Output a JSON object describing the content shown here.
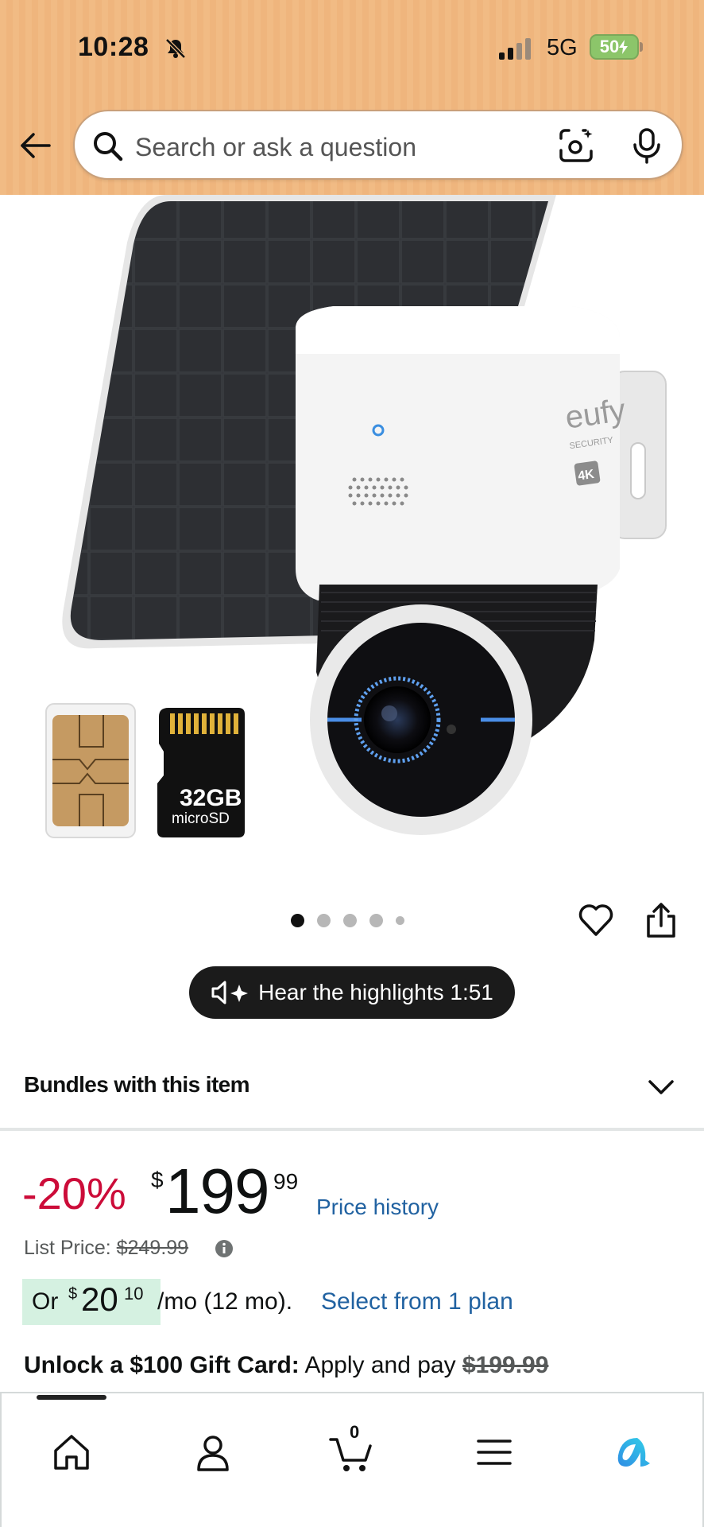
{
  "status_bar": {
    "time": "10:28",
    "network": "5G",
    "battery": "50"
  },
  "search": {
    "placeholder": "Search or ask a question"
  },
  "product_image": {
    "brand_text": "eufy",
    "brand_sub": "SECURITY",
    "badge": "4K",
    "sd_capacity": "32GB",
    "sd_label": "microSD"
  },
  "carousel": {
    "dot_count": 5,
    "active_index": 0
  },
  "highlights": {
    "label": "Hear the highlights 1:51"
  },
  "bundles": {
    "title": "Bundles with this item"
  },
  "price": {
    "discount": "-20%",
    "symbol": "$",
    "whole": "199",
    "cents": "99",
    "history_link": "Price history",
    "list_price_label": "List Price:",
    "list_price_value": "$249.99"
  },
  "installment": {
    "or": "Or",
    "symbol": "$",
    "amount": "20",
    "cents": "10",
    "term": "/mo (12 mo).",
    "link": "Select from 1 plan"
  },
  "gift_card": {
    "bold": "Unlock a $100 Gift Card:",
    "text": "Apply and pay",
    "strike_price": "$199.99"
  },
  "bottom_nav": {
    "cart_count": "0",
    "items": [
      "home-icon",
      "account-icon",
      "cart-icon",
      "menu-icon",
      "alexa-icon"
    ]
  },
  "colors": {
    "header_bg": "#f1bb84",
    "discount": "#cc0c39",
    "link": "#2162a1",
    "installment_bg": "#d5f1e1"
  }
}
